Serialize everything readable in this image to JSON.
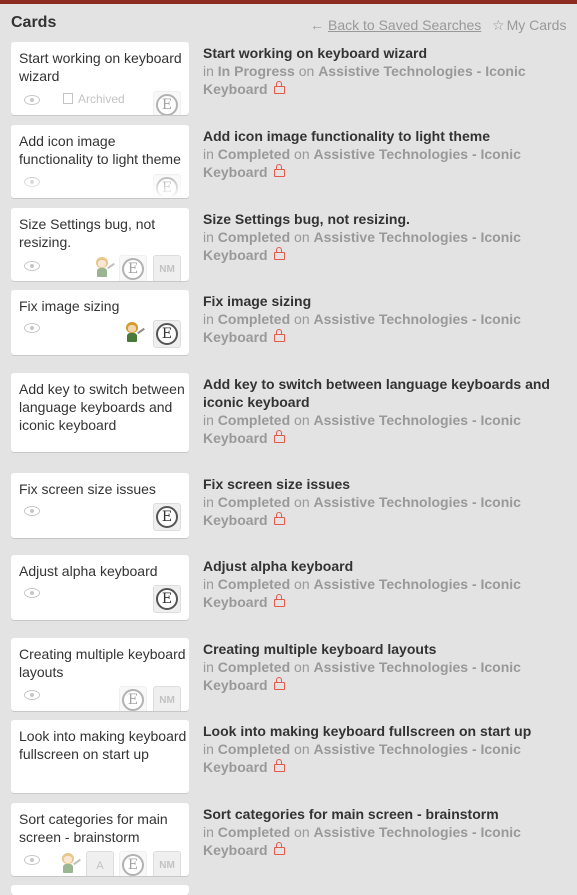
{
  "header": {
    "title": "Cards",
    "back_label": "Back to Saved Searches",
    "my_cards_label": "My Cards"
  },
  "meta_words": {
    "in": "in",
    "on": "on"
  },
  "cards": [
    {
      "title": "Start working on keyboard wizard",
      "list": "In Progress",
      "board_line1": "Assistive Technologies - Iconic",
      "board_line2": "Keyboard",
      "archived_label": "Archived"
    },
    {
      "title": "Add icon image functionality to light theme",
      "list": "Completed",
      "board_line1": "Assistive Technologies - Iconic",
      "board_line2": "Keyboard"
    },
    {
      "title": "Size Settings bug, not resizing.",
      "list": "Completed",
      "board_line1": "Assistive Technologies - Iconic",
      "board_line2": "Keyboard",
      "initials": "NM"
    },
    {
      "title": "Fix image sizing",
      "list": "Completed",
      "board_line1": "Assistive Technologies - Iconic",
      "board_line2": "Keyboard"
    },
    {
      "title": "Add key to switch between language keyboards and iconic keyboard",
      "info_title": "Add key to switch between language keyboards and iconic keyboard",
      "list": "Completed",
      "board_line1": "Assistive Technologies - Iconic",
      "board_line2": "Keyboard"
    },
    {
      "title": "Fix screen size issues",
      "list": "Completed",
      "board_line1": "Assistive Technologies - Iconic",
      "board_line2": "Keyboard"
    },
    {
      "title": "Adjust alpha keyboard",
      "list": "Completed",
      "board_line1": "Assistive Technologies - Iconic",
      "board_line2": "Keyboard"
    },
    {
      "title": "Creating multiple keyboard layouts",
      "list": "Completed",
      "board_line1": "Assistive Technologies - Iconic",
      "board_line2": "Keyboard",
      "initials": "NM"
    },
    {
      "title": "Look into making keyboard fullscreen on start up",
      "list": "Completed",
      "board_line1": "Assistive Technologies - Iconic",
      "board_line2": "Keyboard"
    },
    {
      "title": "Sort categories for main screen - brainstorm",
      "list": "Completed",
      "board_line1": "Assistive Technologies - Iconic",
      "board_line2": "Keyboard",
      "initials": "NM",
      "a_label": "A"
    }
  ],
  "colors": {
    "top_bar": "#8c2b1f",
    "background": "#e3e3e3",
    "card": "#ffffff",
    "muted_text": "#999999",
    "lock": "#e25a4c"
  },
  "icons": {
    "back": "arrow-left-icon",
    "my_cards": "star-icon",
    "watch": "eye-icon",
    "archived": "archive-icon",
    "private_board": "lock-icon"
  }
}
